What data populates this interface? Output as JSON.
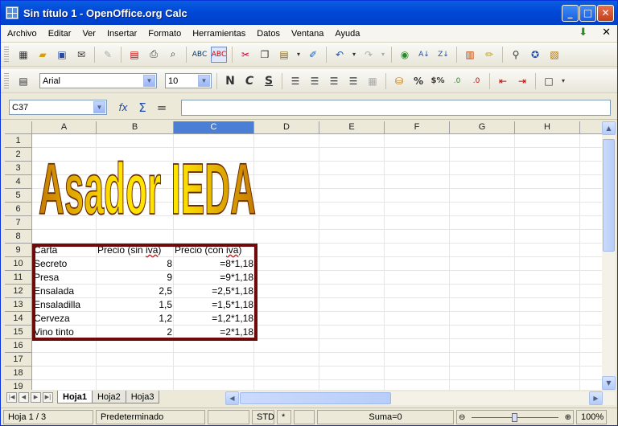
{
  "window": {
    "title": "Sin título 1 - OpenOffice.org Calc",
    "min": "_",
    "max": "□",
    "close": "✕"
  },
  "menu": [
    "Archivo",
    "Editar",
    "Ver",
    "Insertar",
    "Formato",
    "Herramientas",
    "Datos",
    "Ventana",
    "Ayuda"
  ],
  "font": {
    "name": "Arial",
    "size": "10"
  },
  "format": {
    "bold": "N",
    "italic": "C",
    "underline": "S",
    "percent": "%",
    "currency": "$%"
  },
  "formula": {
    "cellref": "C37",
    "fx": "fx",
    "sum": "Σ",
    "equals": "="
  },
  "columns": [
    "A",
    "B",
    "C",
    "D",
    "E",
    "F",
    "G",
    "H"
  ],
  "selected_column": "C",
  "rows": [
    "1",
    "2",
    "3",
    "4",
    "5",
    "6",
    "7",
    "8",
    "9",
    "10",
    "11",
    "12",
    "13",
    "14",
    "15",
    "16",
    "17",
    "18",
    "19"
  ],
  "wordart": "Asador IEDA",
  "table": {
    "header": [
      "Carta",
      "Precio (sin iva)",
      "Precio (con iva)"
    ],
    "rows": [
      [
        "Secreto",
        "8",
        "=8*1,18"
      ],
      [
        "Presa",
        "9",
        "=9*1,18"
      ],
      [
        "Ensalada",
        "2,5",
        "=2,5*1,18"
      ],
      [
        "Ensaladilla",
        "1,5",
        "=1,5*1,18"
      ],
      [
        "Cerveza",
        "1,2",
        "=1,2*1,18"
      ],
      [
        "Vino tinto",
        "2",
        "=2*1,18"
      ]
    ]
  },
  "sheets": [
    "Hoja1",
    "Hoja2",
    "Hoja3"
  ],
  "active_sheet": "Hoja1",
  "status": {
    "page": "Hoja 1 / 3",
    "style": "Predeterminado",
    "mode": "STD",
    "modified": "*",
    "sum": "Suma=0",
    "zoom": "100%"
  },
  "colors": {
    "titlebar": "#0048d8",
    "table_border": "#6e0a0a",
    "wordart_fill": "#f5c400",
    "wordart_outline": "#6b2a00"
  }
}
